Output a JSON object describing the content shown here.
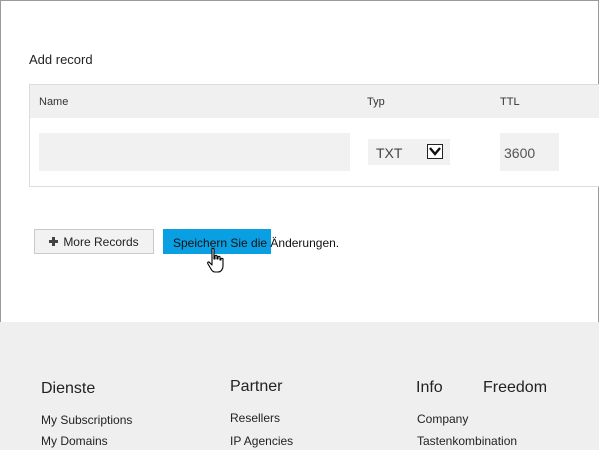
{
  "form": {
    "title": "Add record",
    "columns": {
      "name": "Name",
      "type": "Typ",
      "ttl": "TTL"
    },
    "row": {
      "name_value": "",
      "type_value": "TXT",
      "ttl_value": "3600"
    }
  },
  "actions": {
    "more_records_label": "More Records",
    "save_label": "Speichern Sie die Änderungen."
  },
  "footer": {
    "columns": [
      {
        "heading": "Dienste",
        "links": [
          "My Subscriptions",
          "My Domains"
        ]
      },
      {
        "heading": "Partner",
        "links": [
          "Resellers",
          "IP Agencies"
        ]
      },
      {
        "heading": "Info",
        "links": [
          "Company",
          "Tastenkombination"
        ]
      },
      {
        "heading": "Freedom",
        "links": []
      }
    ]
  }
}
